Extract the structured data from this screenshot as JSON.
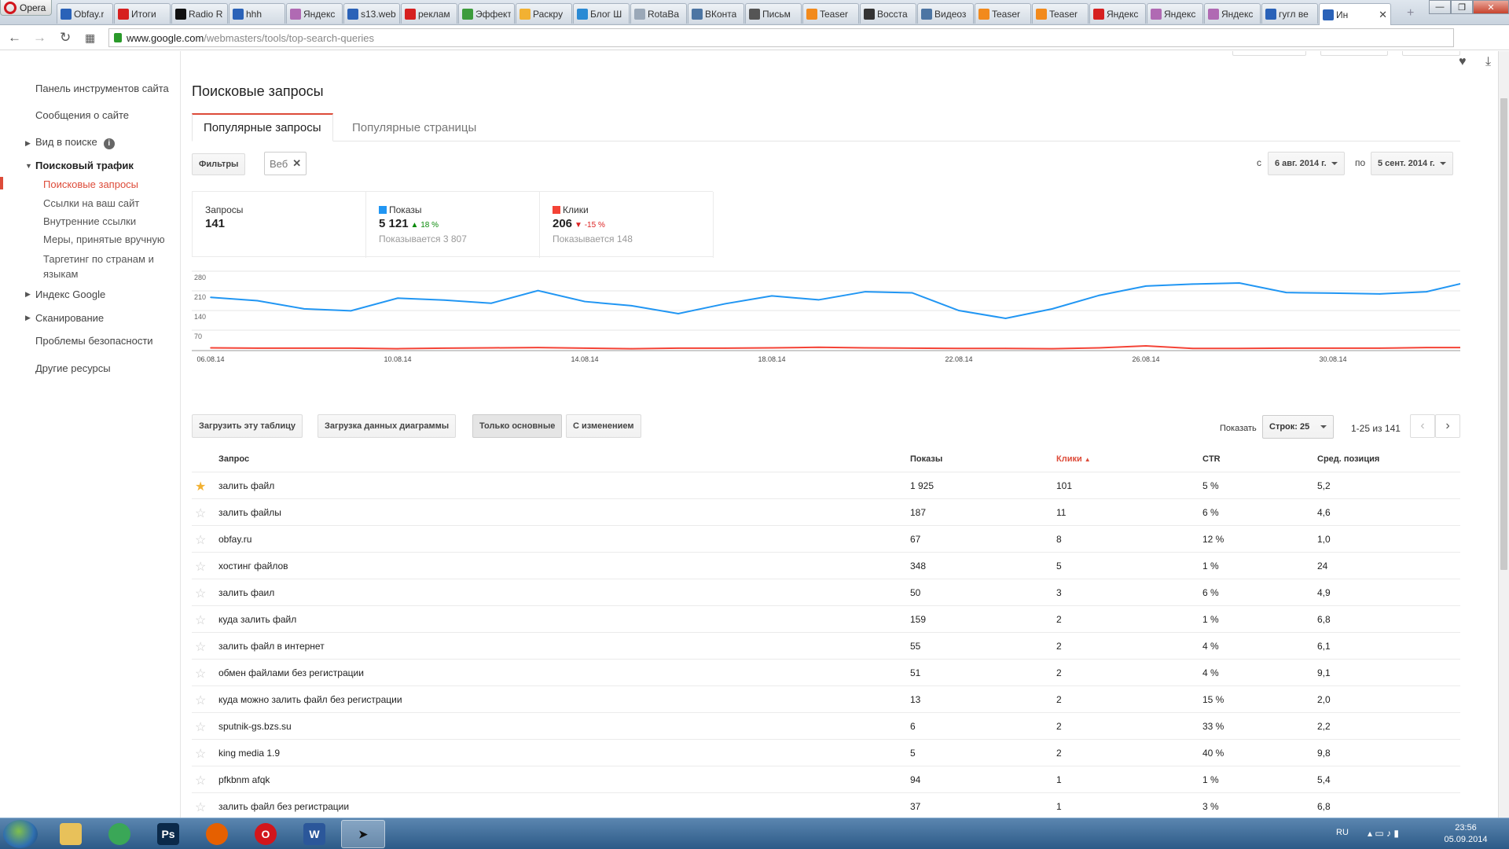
{
  "browser": {
    "menu_label": "Opera",
    "tabs": [
      {
        "label": "Obfay.r",
        "color": "#2a62b8"
      },
      {
        "label": "Итоги",
        "color": "#d62020"
      },
      {
        "label": "Radio R",
        "color": "#111111"
      },
      {
        "label": "hhh",
        "color": "#2a62b8"
      },
      {
        "label": "Яндекс",
        "color": "#b06ab3"
      },
      {
        "label": "s13.web",
        "color": "#2a62b8"
      },
      {
        "label": "реклам",
        "color": "#d62020"
      },
      {
        "label": "Эффект",
        "color": "#3c9c3c"
      },
      {
        "label": "Раскру",
        "color": "#f2b132"
      },
      {
        "label": "Блог Ш",
        "color": "#2a8ad4"
      },
      {
        "label": "RotaBa",
        "color": "#9aa8b8"
      },
      {
        "label": "ВКонта",
        "color": "#4c75a3"
      },
      {
        "label": "Письм",
        "color": "#555555"
      },
      {
        "label": "Teaser",
        "color": "#f28a1c"
      },
      {
        "label": "Восста",
        "color": "#333333"
      },
      {
        "label": "Видеоз",
        "color": "#4c75a3"
      },
      {
        "label": "Teaser",
        "color": "#f28a1c"
      },
      {
        "label": "Teaser",
        "color": "#f28a1c"
      },
      {
        "label": "Яндекс",
        "color": "#d62020"
      },
      {
        "label": "Яндекс",
        "color": "#b06ab3"
      },
      {
        "label": "Яндекс",
        "color": "#b06ab3"
      },
      {
        "label": "гугл ве",
        "color": "#2a62b8"
      }
    ],
    "active_tab": {
      "label": "Ин",
      "color": "#2a62b8"
    },
    "url_domain": "www.google.com",
    "url_path": "/webmasters/tools/top-search-queries"
  },
  "sidebar": {
    "items": [
      {
        "label": "Панель инструментов сайта"
      },
      {
        "label": "Сообщения о сайте"
      },
      {
        "label": "Вид в поиске"
      },
      {
        "label": "Поисковый трафик"
      },
      {
        "label": "Поисковые запросы"
      },
      {
        "label": "Ссылки на ваш сайт"
      },
      {
        "label": "Внутренние ссылки"
      },
      {
        "label": "Меры, принятые вручную"
      },
      {
        "label": "Таргетинг по странам и языкам"
      },
      {
        "label": "Индекс Google"
      },
      {
        "label": "Сканирование"
      },
      {
        "label": "Проблемы безопасности"
      },
      {
        "label": "Другие ресурсы"
      }
    ],
    "info_icon": "i"
  },
  "main": {
    "title": "Поисковые запросы",
    "tabs": [
      {
        "label": "Популярные запросы"
      },
      {
        "label": "Популярные страницы"
      }
    ],
    "filters_button": "Фильтры",
    "filter_chip": "Веб",
    "date_from_label": "с",
    "date_from": "6 авг. 2014 г.",
    "date_to_label": "по",
    "date_to": "5 сент. 2014 г."
  },
  "metrics": [
    {
      "label": "Запросы",
      "value": "141",
      "delta": "",
      "sub": "",
      "color": ""
    },
    {
      "label": "Показы",
      "value": "5 121",
      "delta": "18 %",
      "delta_dir": "up",
      "sub": "Показывается 3 807",
      "color": "#2196f3"
    },
    {
      "label": "Клики",
      "value": "206",
      "delta": "-15 %",
      "delta_dir": "down",
      "sub": "Показывается 148",
      "color": "#f44336"
    }
  ],
  "chart_data": {
    "type": "line",
    "x": [
      "06.08.14",
      "07.08.14",
      "08.08.14",
      "09.08.14",
      "10.08.14",
      "11.08.14",
      "12.08.14",
      "13.08.14",
      "14.08.14",
      "15.08.14",
      "16.08.14",
      "17.08.14",
      "18.08.14",
      "19.08.14",
      "20.08.14",
      "21.08.14",
      "22.08.14",
      "23.08.14",
      "24.08.14",
      "25.08.14",
      "26.08.14",
      "27.08.14",
      "28.08.14",
      "29.08.14",
      "30.08.14",
      "31.08.14",
      "01.09.14",
      "02.09.14"
    ],
    "x_tick_labels": [
      "06.08.14",
      "10.08.14",
      "14.08.14",
      "18.08.14",
      "22.08.14",
      "26.08.14",
      "30.08.14"
    ],
    "y_ticks": [
      70,
      140,
      210,
      280
    ],
    "ylim": [
      0,
      280
    ],
    "series": [
      {
        "name": "Показы",
        "color": "#2196f3",
        "values": [
          187,
          175,
          146,
          139,
          184,
          177,
          166,
          211,
          172,
          157,
          129,
          164,
          192,
          178,
          207,
          203,
          140,
          112,
          146,
          194,
          227,
          234,
          238,
          204,
          202,
          199,
          207,
          246
        ]
      },
      {
        "name": "Клики",
        "color": "#f44336",
        "values": [
          7,
          6,
          6,
          6,
          4,
          6,
          7,
          8,
          6,
          4,
          6,
          6,
          7,
          9,
          7,
          6,
          5,
          5,
          4,
          7,
          14,
          5,
          5,
          6,
          6,
          6,
          8,
          8
        ]
      }
    ]
  },
  "toolbar": {
    "download_table": "Загрузить эту таблицу",
    "download_chart": "Загрузка данных диаграммы",
    "only_main": "Только основные",
    "with_change": "С изменением",
    "show_label": "Показать",
    "rows_label": "Строк: 25",
    "range_label": "1-25 из 141"
  },
  "table": {
    "headers": {
      "query": "Запрос",
      "impressions": "Показы",
      "clicks": "Клики",
      "ctr": "CTR",
      "position": "Сред. позиция"
    },
    "rows": [
      {
        "query": "залить файл",
        "impressions": "1 925",
        "clicks": "101",
        "ctr": "5 %",
        "position": "5,2",
        "starred": true
      },
      {
        "query": "залить файлы",
        "impressions": "187",
        "clicks": "11",
        "ctr": "6 %",
        "position": "4,6",
        "starred": false
      },
      {
        "query": "obfay.ru",
        "impressions": "67",
        "clicks": "8",
        "ctr": "12 %",
        "position": "1,0",
        "starred": false
      },
      {
        "query": "хостинг файлов",
        "impressions": "348",
        "clicks": "5",
        "ctr": "1 %",
        "position": "24",
        "starred": false
      },
      {
        "query": "залить фаил",
        "impressions": "50",
        "clicks": "3",
        "ctr": "6 %",
        "position": "4,9",
        "starred": false
      },
      {
        "query": "куда залить файл",
        "impressions": "159",
        "clicks": "2",
        "ctr": "1 %",
        "position": "6,8",
        "starred": false
      },
      {
        "query": "залить файл в интернет",
        "impressions": "55",
        "clicks": "2",
        "ctr": "4 %",
        "position": "6,1",
        "starred": false
      },
      {
        "query": "обмен файлами без регистрации",
        "impressions": "51",
        "clicks": "2",
        "ctr": "4 %",
        "position": "9,1",
        "starred": false
      },
      {
        "query": "куда можно залить файл без регистрации",
        "impressions": "13",
        "clicks": "2",
        "ctr": "15 %",
        "position": "2,0",
        "starred": false
      },
      {
        "query": "sputnik-gs.bzs.su",
        "impressions": "6",
        "clicks": "2",
        "ctr": "33 %",
        "position": "2,2",
        "starred": false
      },
      {
        "query": "king media 1.9",
        "impressions": "5",
        "clicks": "2",
        "ctr": "40 %",
        "position": "9,8",
        "starred": false
      },
      {
        "query": "pfkbnm afqk",
        "impressions": "94",
        "clicks": "1",
        "ctr": "1 %",
        "position": "5,4",
        "starred": false
      },
      {
        "query": "залить файл без регистрации",
        "impressions": "37",
        "clicks": "1",
        "ctr": "3 %",
        "position": "6,8",
        "starred": false
      }
    ]
  },
  "taskbar": {
    "apps": [
      {
        "name": "explorer",
        "color": "#e8c15a",
        "glyph": ""
      },
      {
        "name": "chrome",
        "color": "#3aa757",
        "glyph": ""
      },
      {
        "name": "photoshop",
        "color": "#0b2a4a",
        "glyph": "Ps"
      },
      {
        "name": "firefox",
        "color": "#e66000",
        "glyph": ""
      },
      {
        "name": "opera",
        "color": "#d2161c",
        "glyph": "O"
      },
      {
        "name": "word",
        "color": "#2b579a",
        "glyph": "W"
      },
      {
        "name": "cursor-app",
        "color": "#ffffff",
        "glyph": "➤"
      }
    ],
    "lang": "RU",
    "time": "23:56",
    "date": "05.09.2014"
  }
}
